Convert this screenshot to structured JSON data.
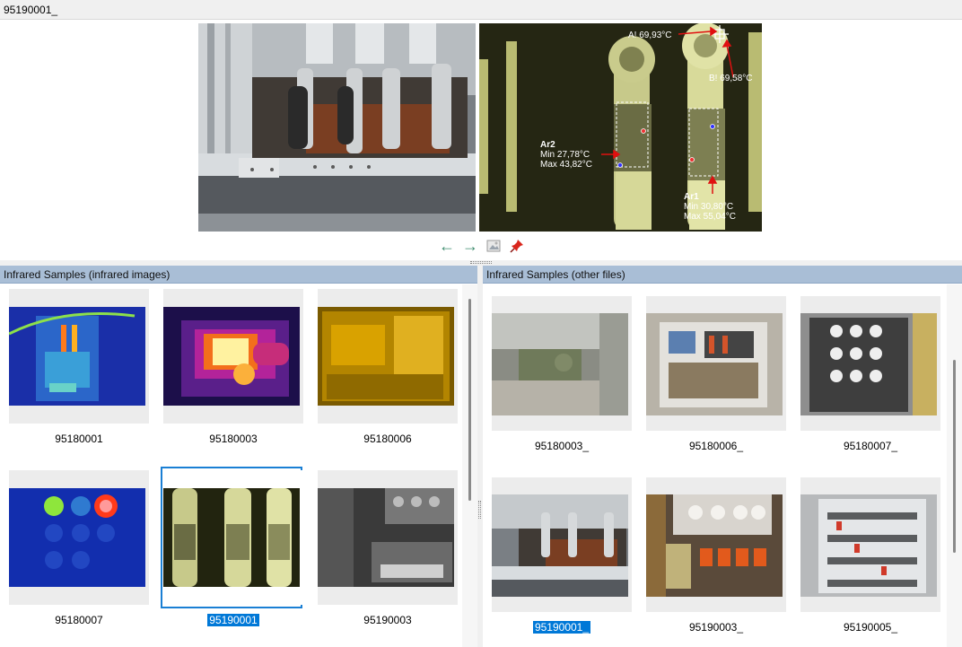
{
  "window": {
    "title": "95190001_"
  },
  "thermal_labels": {
    "a_point": "A! 69,93°C",
    "b_point": "B! 69,58°C",
    "ar2_name": "Ar2",
    "ar2_min": "Min  27,78°C",
    "ar2_max": "Max  43,82°C",
    "ar1_name": "Ar1",
    "ar1_min": "Min  30,80°C",
    "ar1_max": "Max  55,04°C"
  },
  "toolbar": {
    "icons": [
      "arrow-left-icon",
      "arrow-right-icon",
      "image-icon",
      "pin-icon"
    ]
  },
  "left_panel": {
    "header": "Infrared Samples (infrared images)",
    "items": [
      {
        "label": "95180001",
        "selected": false
      },
      {
        "label": "95180003",
        "selected": false
      },
      {
        "label": "95180006",
        "selected": false
      },
      {
        "label": "95180007",
        "selected": false
      },
      {
        "label": "95190001",
        "selected": true
      },
      {
        "label": "95190003",
        "selected": false
      }
    ]
  },
  "right_panel": {
    "header": "Infrared Samples (other files)",
    "items": [
      {
        "label": "95180003_",
        "selected": false
      },
      {
        "label": "95180006_",
        "selected": false
      },
      {
        "label": "95180007_",
        "selected": false
      },
      {
        "label": "95190001_",
        "selected": true
      },
      {
        "label": "95190003_",
        "selected": false
      },
      {
        "label": "95190005_",
        "selected": false
      }
    ]
  },
  "colors": {
    "header_bg": "#a9bed6",
    "selection": "#0078d7",
    "arrow_green": "#3e8c6e",
    "pin_red": "#d9261c"
  }
}
